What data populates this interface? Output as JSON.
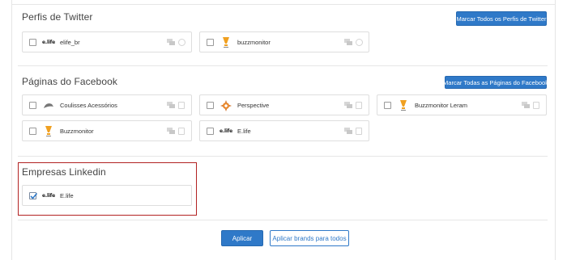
{
  "twitter": {
    "title": "Perfis de Twitter",
    "mark_all": "Marcar Todos os Perfis de Twitter",
    "items": [
      {
        "name": "elife_br",
        "logo": "elife-logo",
        "logo_text": "e.life"
      },
      {
        "name": "buzzmonitor",
        "logo": "buzzmonitor-logo"
      }
    ]
  },
  "facebook": {
    "title": "Páginas do Facebook",
    "mark_all": "Marcar Todas as Páginas do Facebook",
    "items": [
      {
        "name": "Coulisses Acessórios",
        "logo": "coulisses-logo"
      },
      {
        "name": "Perspective",
        "logo": "perspective-logo"
      },
      {
        "name": "Buzzmonitor Leram",
        "logo": "buzzmonitor-logo"
      },
      {
        "name": "Buzzmonitor",
        "logo": "buzzmonitor-logo"
      },
      {
        "name": "E.life",
        "logo": "elife-logo",
        "logo_text": "e.life"
      }
    ]
  },
  "linkedin": {
    "title": "Empresas Linkedin",
    "items": [
      {
        "name": "E.life",
        "logo": "elife-logo",
        "logo_text": "e.life",
        "checked": true
      }
    ]
  },
  "footer": {
    "apply": "Aplicar",
    "apply_all": "Aplicar brands para todos"
  },
  "colors": {
    "accent": "#2f79c8",
    "highlight": "#b22222",
    "buzz_orange": "#f0a020"
  }
}
